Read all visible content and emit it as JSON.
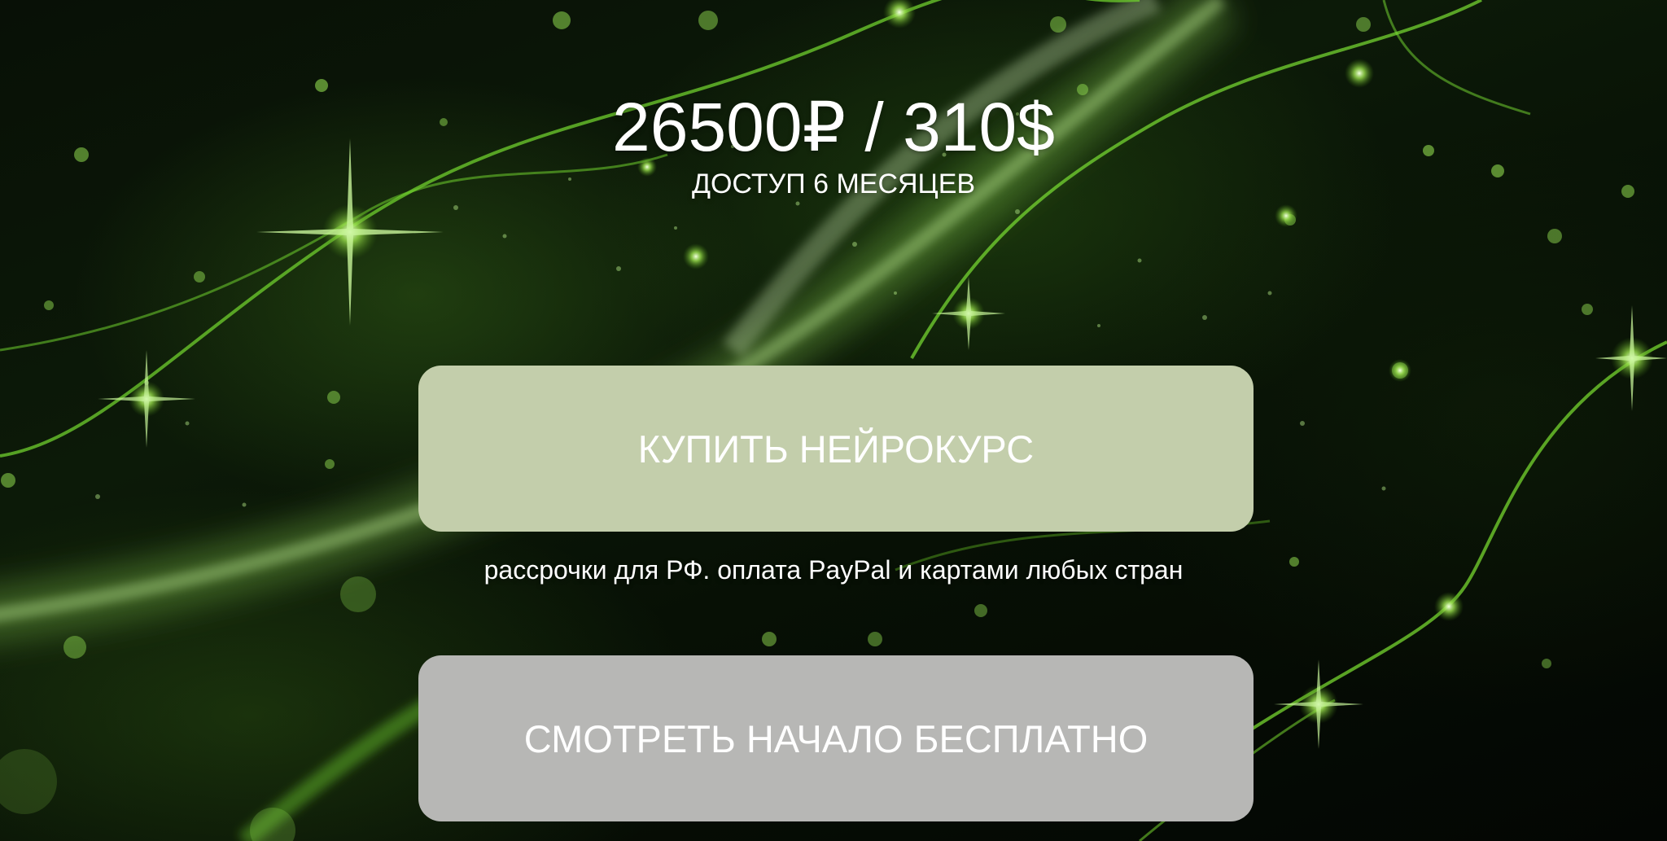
{
  "offer": {
    "price": "26500₽ / 310$",
    "access": "ДОСТУП 6 МЕСЯЦЕВ"
  },
  "actions": {
    "buy_label": "КУПИТЬ НЕЙРОКУРС",
    "payment_note": "рассрочки для РФ. оплата PayPal и картами любых стран",
    "free_label": "СМОТРЕТЬ НАЧАЛО БЕСПЛАТНО"
  },
  "colors": {
    "buy_button": "#c3ceab",
    "free_button": "#b7b7b5",
    "text": "#ffffff",
    "accent_glow": "#7fd23a"
  },
  "background": {
    "icon": "green-neural-network-particles-image"
  }
}
